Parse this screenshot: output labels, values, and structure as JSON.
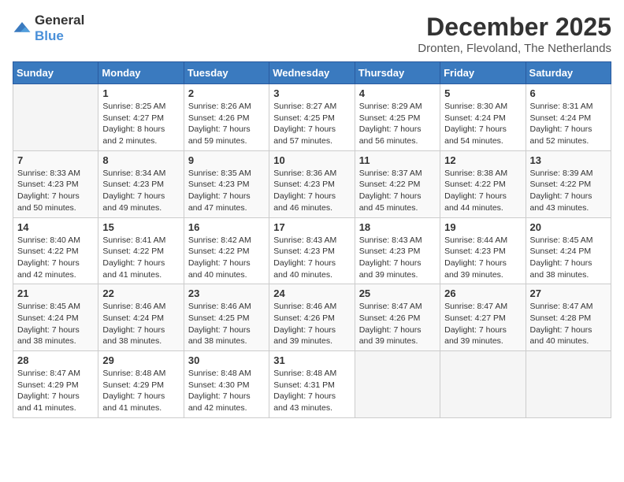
{
  "logo": {
    "general": "General",
    "blue": "Blue"
  },
  "header": {
    "month": "December 2025",
    "location": "Dronten, Flevoland, The Netherlands"
  },
  "weekdays": [
    "Sunday",
    "Monday",
    "Tuesday",
    "Wednesday",
    "Thursday",
    "Friday",
    "Saturday"
  ],
  "weeks": [
    [
      {
        "day": "",
        "content": ""
      },
      {
        "day": "1",
        "content": "Sunrise: 8:25 AM\nSunset: 4:27 PM\nDaylight: 8 hours\nand 2 minutes."
      },
      {
        "day": "2",
        "content": "Sunrise: 8:26 AM\nSunset: 4:26 PM\nDaylight: 7 hours\nand 59 minutes."
      },
      {
        "day": "3",
        "content": "Sunrise: 8:27 AM\nSunset: 4:25 PM\nDaylight: 7 hours\nand 57 minutes."
      },
      {
        "day": "4",
        "content": "Sunrise: 8:29 AM\nSunset: 4:25 PM\nDaylight: 7 hours\nand 56 minutes."
      },
      {
        "day": "5",
        "content": "Sunrise: 8:30 AM\nSunset: 4:24 PM\nDaylight: 7 hours\nand 54 minutes."
      },
      {
        "day": "6",
        "content": "Sunrise: 8:31 AM\nSunset: 4:24 PM\nDaylight: 7 hours\nand 52 minutes."
      }
    ],
    [
      {
        "day": "7",
        "content": "Sunrise: 8:33 AM\nSunset: 4:23 PM\nDaylight: 7 hours\nand 50 minutes."
      },
      {
        "day": "8",
        "content": "Sunrise: 8:34 AM\nSunset: 4:23 PM\nDaylight: 7 hours\nand 49 minutes."
      },
      {
        "day": "9",
        "content": "Sunrise: 8:35 AM\nSunset: 4:23 PM\nDaylight: 7 hours\nand 47 minutes."
      },
      {
        "day": "10",
        "content": "Sunrise: 8:36 AM\nSunset: 4:23 PM\nDaylight: 7 hours\nand 46 minutes."
      },
      {
        "day": "11",
        "content": "Sunrise: 8:37 AM\nSunset: 4:22 PM\nDaylight: 7 hours\nand 45 minutes."
      },
      {
        "day": "12",
        "content": "Sunrise: 8:38 AM\nSunset: 4:22 PM\nDaylight: 7 hours\nand 44 minutes."
      },
      {
        "day": "13",
        "content": "Sunrise: 8:39 AM\nSunset: 4:22 PM\nDaylight: 7 hours\nand 43 minutes."
      }
    ],
    [
      {
        "day": "14",
        "content": "Sunrise: 8:40 AM\nSunset: 4:22 PM\nDaylight: 7 hours\nand 42 minutes."
      },
      {
        "day": "15",
        "content": "Sunrise: 8:41 AM\nSunset: 4:22 PM\nDaylight: 7 hours\nand 41 minutes."
      },
      {
        "day": "16",
        "content": "Sunrise: 8:42 AM\nSunset: 4:22 PM\nDaylight: 7 hours\nand 40 minutes."
      },
      {
        "day": "17",
        "content": "Sunrise: 8:43 AM\nSunset: 4:23 PM\nDaylight: 7 hours\nand 40 minutes."
      },
      {
        "day": "18",
        "content": "Sunrise: 8:43 AM\nSunset: 4:23 PM\nDaylight: 7 hours\nand 39 minutes."
      },
      {
        "day": "19",
        "content": "Sunrise: 8:44 AM\nSunset: 4:23 PM\nDaylight: 7 hours\nand 39 minutes."
      },
      {
        "day": "20",
        "content": "Sunrise: 8:45 AM\nSunset: 4:24 PM\nDaylight: 7 hours\nand 38 minutes."
      }
    ],
    [
      {
        "day": "21",
        "content": "Sunrise: 8:45 AM\nSunset: 4:24 PM\nDaylight: 7 hours\nand 38 minutes."
      },
      {
        "day": "22",
        "content": "Sunrise: 8:46 AM\nSunset: 4:24 PM\nDaylight: 7 hours\nand 38 minutes."
      },
      {
        "day": "23",
        "content": "Sunrise: 8:46 AM\nSunset: 4:25 PM\nDaylight: 7 hours\nand 38 minutes."
      },
      {
        "day": "24",
        "content": "Sunrise: 8:46 AM\nSunset: 4:26 PM\nDaylight: 7 hours\nand 39 minutes."
      },
      {
        "day": "25",
        "content": "Sunrise: 8:47 AM\nSunset: 4:26 PM\nDaylight: 7 hours\nand 39 minutes."
      },
      {
        "day": "26",
        "content": "Sunrise: 8:47 AM\nSunset: 4:27 PM\nDaylight: 7 hours\nand 39 minutes."
      },
      {
        "day": "27",
        "content": "Sunrise: 8:47 AM\nSunset: 4:28 PM\nDaylight: 7 hours\nand 40 minutes."
      }
    ],
    [
      {
        "day": "28",
        "content": "Sunrise: 8:47 AM\nSunset: 4:29 PM\nDaylight: 7 hours\nand 41 minutes."
      },
      {
        "day": "29",
        "content": "Sunrise: 8:48 AM\nSunset: 4:29 PM\nDaylight: 7 hours\nand 41 minutes."
      },
      {
        "day": "30",
        "content": "Sunrise: 8:48 AM\nSunset: 4:30 PM\nDaylight: 7 hours\nand 42 minutes."
      },
      {
        "day": "31",
        "content": "Sunrise: 8:48 AM\nSunset: 4:31 PM\nDaylight: 7 hours\nand 43 minutes."
      },
      {
        "day": "",
        "content": ""
      },
      {
        "day": "",
        "content": ""
      },
      {
        "day": "",
        "content": ""
      }
    ]
  ]
}
